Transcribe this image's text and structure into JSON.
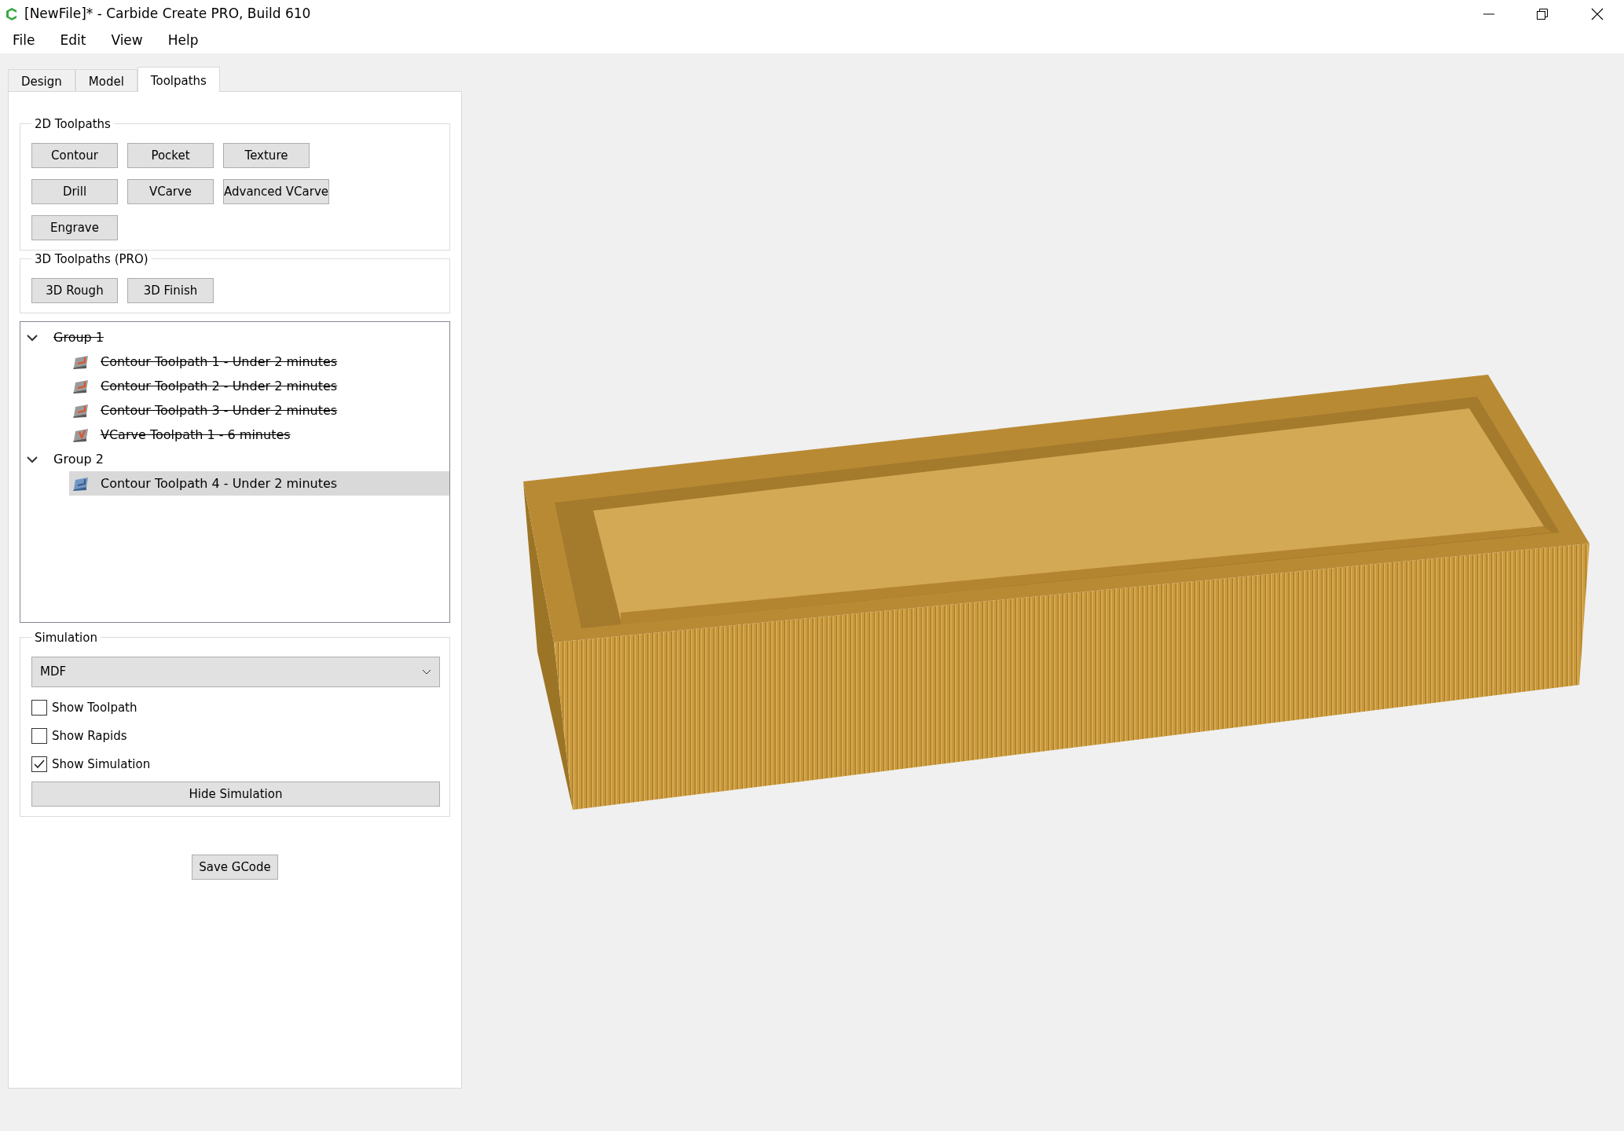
{
  "window": {
    "title": "[NewFile]* - Carbide Create PRO, Build 610"
  },
  "menu": [
    "File",
    "Edit",
    "View",
    "Help"
  ],
  "tabs": [
    {
      "label": "Design",
      "selected": false
    },
    {
      "label": "Model",
      "selected": false
    },
    {
      "label": "Toolpaths",
      "selected": true
    }
  ],
  "toolpaths_2d": {
    "title": "2D Toolpaths",
    "buttons": [
      "Contour",
      "Pocket",
      "Texture",
      "Drill",
      "VCarve",
      "Advanced VCarve",
      "Engrave"
    ]
  },
  "toolpaths_3d": {
    "title": "3D Toolpaths (PRO)",
    "buttons": [
      "3D Rough",
      "3D Finish"
    ]
  },
  "toolpath_tree": [
    {
      "label": "Group 1",
      "expanded": true,
      "disabled": true,
      "children": [
        {
          "label": "Contour Toolpath 1 - Under 2 minutes",
          "kind": "contour",
          "disabled": true,
          "selected": false
        },
        {
          "label": "Contour Toolpath 2 - Under 2 minutes",
          "kind": "contour",
          "disabled": true,
          "selected": false
        },
        {
          "label": "Contour Toolpath 3 - Under 2 minutes",
          "kind": "contour",
          "disabled": true,
          "selected": false
        },
        {
          "label": "VCarve Toolpath 1 - 6 minutes",
          "kind": "vcarve",
          "disabled": true,
          "selected": false
        }
      ]
    },
    {
      "label": "Group 2",
      "expanded": true,
      "disabled": false,
      "children": [
        {
          "label": "Contour Toolpath 4 - Under 2 minutes",
          "kind": "contour",
          "disabled": false,
          "selected": true
        }
      ]
    }
  ],
  "simulation": {
    "title": "Simulation",
    "material": {
      "value": "MDF"
    },
    "checkboxes": [
      {
        "label": "Show Toolpath",
        "checked": false
      },
      {
        "label": "Show Rapids",
        "checked": false
      },
      {
        "label": "Show Simulation",
        "checked": true
      }
    ],
    "button": "Hide Simulation"
  },
  "save_button": "Save GCode"
}
